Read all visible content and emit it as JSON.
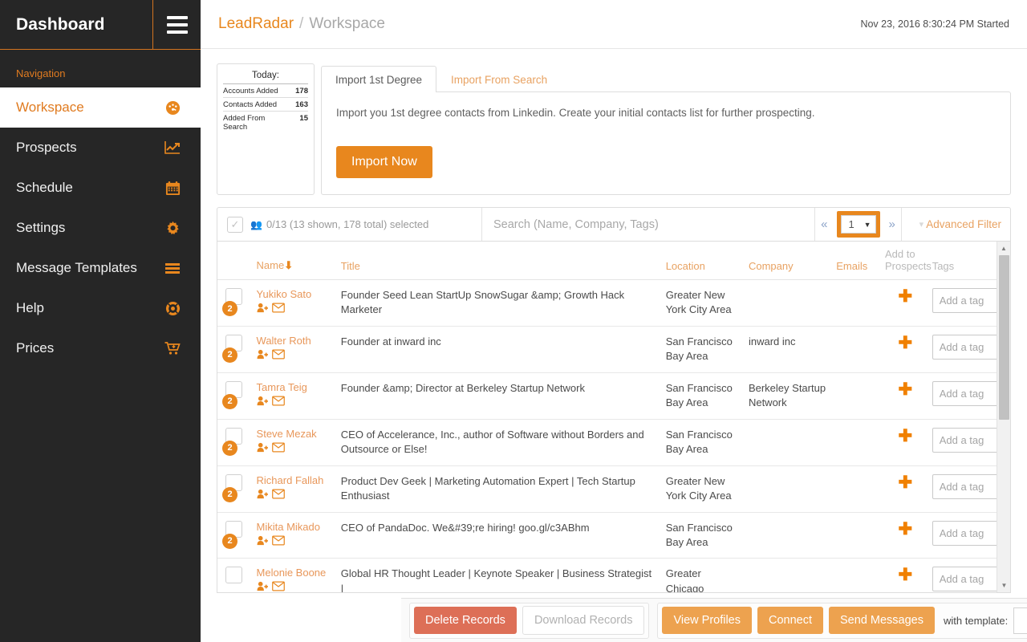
{
  "sidebar": {
    "brand": "Dashboard",
    "burger_icon": "hamburger-menu-icon",
    "nav_label": "Navigation",
    "items": [
      {
        "label": "Workspace",
        "icon": "dashboard-gauge-icon",
        "active": true
      },
      {
        "label": "Prospects",
        "icon": "line-chart-icon",
        "active": false
      },
      {
        "label": "Schedule",
        "icon": "calendar-icon",
        "active": false
      },
      {
        "label": "Settings",
        "icon": "gear-icon",
        "active": false
      },
      {
        "label": "Message Templates",
        "icon": "list-bars-icon",
        "active": false
      },
      {
        "label": "Help",
        "icon": "life-ring-icon",
        "active": false
      },
      {
        "label": "Prices",
        "icon": "shopping-cart-icon",
        "active": false
      }
    ]
  },
  "header": {
    "brand": "LeadRadar",
    "separator": "/",
    "current": "Workspace",
    "status": "Nov 23, 2016 8:30:24 PM Started"
  },
  "today_card": {
    "title": "Today:",
    "rows": [
      {
        "label": "Accounts Added",
        "value": "178"
      },
      {
        "label": "Contacts Added",
        "value": "163"
      },
      {
        "label": "Added From Search",
        "value": "15"
      }
    ]
  },
  "import_panel": {
    "tabs": [
      {
        "label": "Import 1st Degree",
        "active": true
      },
      {
        "label": "Import From Search",
        "active": false
      }
    ],
    "description": "Import you 1st degree contacts from Linkedin. Create your initial contacts list for further prospecting.",
    "button": "Import Now"
  },
  "toolbar": {
    "select_all_icon": "checkbox-icon",
    "group_icon": "group-users-icon",
    "selection_text": "0/13 (13 shown, 178 total) selected",
    "search_placeholder": "Search (Name, Company, Tags)",
    "prev_label": "«",
    "next_label": "»",
    "page_value": "1",
    "page_options": [
      "1"
    ],
    "filter_icon": "funnel-icon",
    "filter_label": "Advanced Filter"
  },
  "table": {
    "columns": [
      {
        "label": "",
        "key": "chk",
        "muted": false
      },
      {
        "label": "Name",
        "key": "name",
        "muted": false,
        "sort": "↓"
      },
      {
        "label": "Title",
        "key": "title",
        "muted": false
      },
      {
        "label": "Location",
        "key": "location",
        "muted": false
      },
      {
        "label": "Company",
        "key": "company",
        "muted": false
      },
      {
        "label": "Emails",
        "key": "emails",
        "muted": false
      },
      {
        "label": "Add to Prospects",
        "key": "add",
        "muted": true
      },
      {
        "label": "Tags",
        "key": "tags",
        "muted": true
      }
    ],
    "tag_placeholder": "Add a tag",
    "add_icon": "plus-icon",
    "row_icons": [
      "add-person-icon",
      "envelope-icon"
    ],
    "rows": [
      {
        "badge": "2",
        "name": "Yukiko Sato",
        "title": "Founder Seed Lean StartUp SnowSugar &amp; Growth Hack Marketer",
        "location": "Greater New York City Area",
        "company": "",
        "emails": ""
      },
      {
        "badge": "2",
        "name": "Walter Roth",
        "title": "Founder at inward inc",
        "location": "San Francisco Bay Area",
        "company": "inward inc",
        "emails": ""
      },
      {
        "badge": "2",
        "name": "Tamra Teig",
        "title": "Founder &amp; Director at Berkeley Startup Network",
        "location": "San Francisco Bay Area",
        "company": "Berkeley Startup Network",
        "emails": ""
      },
      {
        "badge": "2",
        "name": "Steve Mezak",
        "title": "CEO of Accelerance, Inc., author of Software without Borders and Outsource or Else!",
        "location": "San Francisco Bay Area",
        "company": "",
        "emails": ""
      },
      {
        "badge": "2",
        "name": "Richard Fallah",
        "title": "Product Dev Geek | Marketing Automation Expert | Tech Startup Enthusiast",
        "location": "Greater New York City Area",
        "company": "",
        "emails": ""
      },
      {
        "badge": "2",
        "name": "Mikita Mikado",
        "title": "CEO of PandaDoc. We&#39;re hiring! goo.gl/c3ABhm",
        "location": "San Francisco Bay Area",
        "company": "",
        "emails": ""
      },
      {
        "badge": "",
        "name": "Melonie Boone",
        "title": "Global HR Thought Leader | Keynote Speaker | Business Strategist |",
        "location": "Greater Chicago",
        "company": "",
        "emails": ""
      }
    ]
  },
  "footer": {
    "delete_label": "Delete Records",
    "download_label": "Download Records",
    "view_profiles_label": "View Profiles",
    "connect_label": "Connect",
    "send_messages_label": "Send Messages",
    "with_template_label": "with template:",
    "template_value": "",
    "template_options": [
      ""
    ]
  },
  "colors": {
    "accent": "#e8871e",
    "sidebar_bg": "#262626",
    "danger": "#dd6f57",
    "muted": "#a8a8a8"
  }
}
